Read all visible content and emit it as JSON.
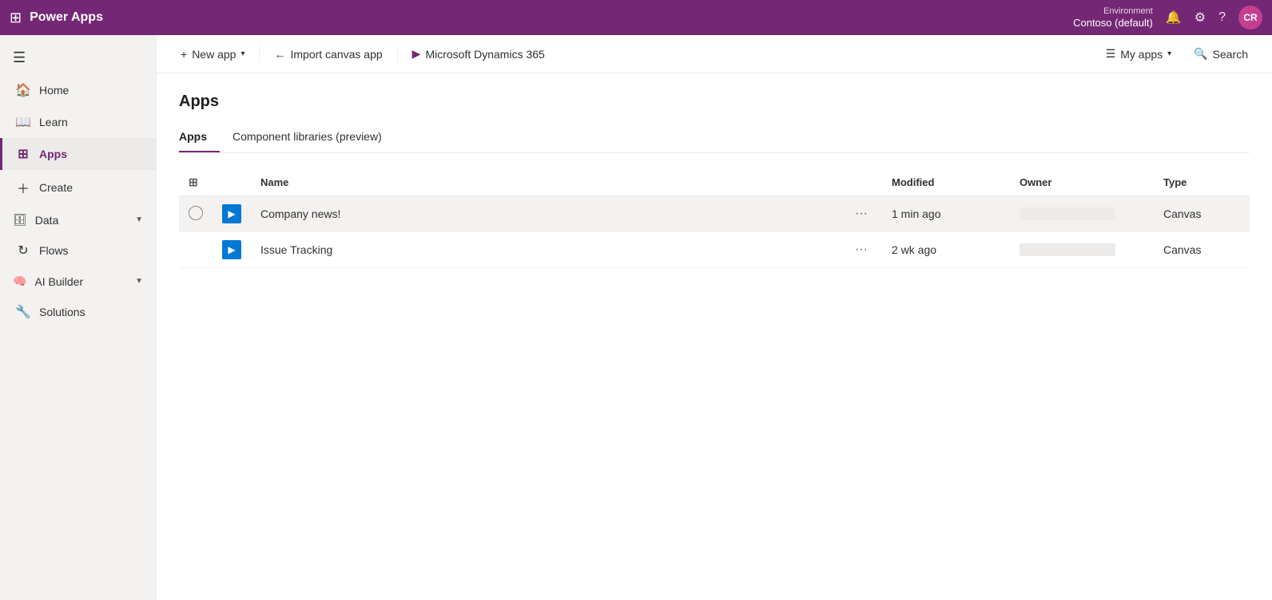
{
  "topbar": {
    "app_name": "Power Apps",
    "environment_label": "Environment",
    "environment_name": "Contoso (default)",
    "avatar_initials": "CR"
  },
  "sidebar": {
    "toggle_label": "Toggle navigation",
    "items": [
      {
        "id": "home",
        "label": "Home",
        "icon": "🏠"
      },
      {
        "id": "learn",
        "label": "Learn",
        "icon": "📖"
      },
      {
        "id": "apps",
        "label": "Apps",
        "icon": "⊞",
        "active": true
      },
      {
        "id": "create",
        "label": "Create",
        "icon": "＋"
      },
      {
        "id": "data",
        "label": "Data",
        "icon": "🗄",
        "has_arrow": true
      },
      {
        "id": "flows",
        "label": "Flows",
        "icon": "↻"
      },
      {
        "id": "ai-builder",
        "label": "AI Builder",
        "icon": "🧠",
        "has_arrow": true
      },
      {
        "id": "solutions",
        "label": "Solutions",
        "icon": "🔧"
      }
    ]
  },
  "toolbar": {
    "new_app_label": "New app",
    "import_canvas_label": "Import canvas app",
    "dynamics_label": "Microsoft Dynamics 365",
    "my_apps_label": "My apps",
    "search_label": "Search"
  },
  "page": {
    "title": "Apps",
    "tabs": [
      {
        "id": "apps",
        "label": "Apps",
        "active": true
      },
      {
        "id": "component-libraries",
        "label": "Component libraries (preview)",
        "active": false
      }
    ],
    "table": {
      "columns": [
        {
          "id": "checkbox",
          "label": ""
        },
        {
          "id": "icon",
          "label": ""
        },
        {
          "id": "name",
          "label": "Name"
        },
        {
          "id": "more",
          "label": ""
        },
        {
          "id": "modified",
          "label": "Modified"
        },
        {
          "id": "owner",
          "label": "Owner"
        },
        {
          "id": "type",
          "label": "Type"
        }
      ],
      "rows": [
        {
          "id": "company-news",
          "name": "Company news!",
          "modified": "1 min ago",
          "type": "Canvas",
          "highlighted": true
        },
        {
          "id": "issue-tracking",
          "name": "Issue Tracking",
          "modified": "2 wk ago",
          "type": "Canvas",
          "highlighted": false
        }
      ]
    }
  }
}
